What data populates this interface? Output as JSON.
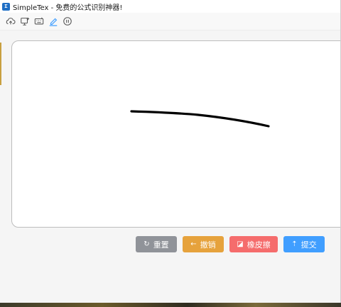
{
  "window": {
    "title": "SimpleTex - 免费的公式识别神器!",
    "icon": "simpletex-app-icon"
  },
  "toolbar": {
    "tools": [
      {
        "name": "upload-cloud-icon"
      },
      {
        "name": "screen-capture-icon"
      },
      {
        "name": "keyboard-icon"
      },
      {
        "name": "handwrite-icon",
        "active": true
      },
      {
        "name": "pause-icon"
      }
    ]
  },
  "canvas": {
    "stroke_color": "#000000"
  },
  "actions": {
    "reset": {
      "label": "重置",
      "icon": "refresh-icon",
      "color": "#909399"
    },
    "undo": {
      "label": "撤销",
      "icon": "arrow-left-icon",
      "color": "#e6a23c"
    },
    "eraser": {
      "label": "橡皮擦",
      "icon": "eraser-icon",
      "color": "#f56c6c"
    },
    "submit": {
      "label": "提交",
      "icon": "upload-icon",
      "color": "#409eff"
    }
  }
}
